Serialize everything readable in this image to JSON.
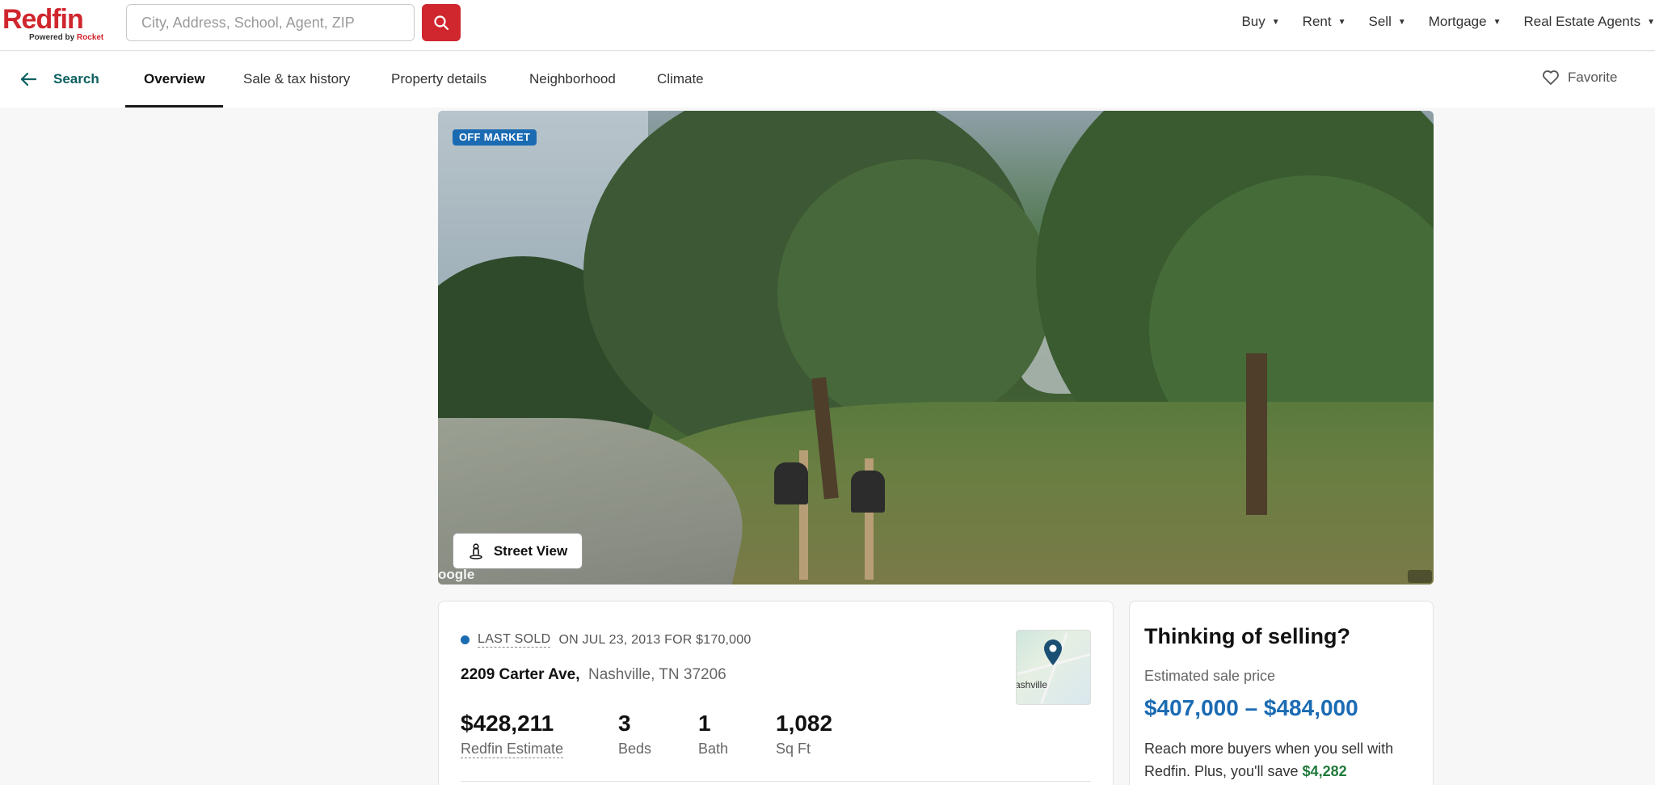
{
  "header": {
    "logo_text": "Redfin",
    "logo_sub_prefix": "Powered by",
    "logo_sub_brand": "Rocket",
    "search_placeholder": "City, Address, School, Agent, ZIP",
    "nav": [
      {
        "label": "Buy"
      },
      {
        "label": "Rent"
      },
      {
        "label": "Sell"
      },
      {
        "label": "Mortgage"
      },
      {
        "label": "Real Estate Agents"
      }
    ]
  },
  "subnav": {
    "back_label": "Search",
    "tabs": [
      {
        "label": "Overview",
        "active": true
      },
      {
        "label": "Sale & tax history"
      },
      {
        "label": "Property details"
      },
      {
        "label": "Neighborhood"
      },
      {
        "label": "Climate"
      }
    ],
    "favorite_label": "Favorite"
  },
  "photo": {
    "badge": "OFF MARKET",
    "street_view_label": "Street View",
    "watermark": "oogle"
  },
  "listing": {
    "sold_label": "LAST SOLD",
    "sold_detail": "ON JUL 23, 2013 FOR $170,000",
    "street": "2209 Carter Ave,",
    "city": "Nashville, TN 37206",
    "map_city_label": "ashville",
    "stats": [
      {
        "value": "$428,211",
        "label": "Redfin Estimate"
      },
      {
        "value": "3",
        "label": "Beds"
      },
      {
        "value": "1",
        "label": "Bath"
      },
      {
        "value": "1,082",
        "label": "Sq Ft"
      }
    ]
  },
  "selling": {
    "title": "Thinking of selling?",
    "subtitle": "Estimated sale price",
    "price_range": "$407,000 – $484,000",
    "text": "Reach more buyers when you sell with Redfin. Plus, you'll save",
    "savings": "$4,282"
  },
  "colors": {
    "brand_red": "#d0262e",
    "accent_blue": "#1b6bb3",
    "teal_link": "#0b5f5f",
    "savings_green": "#1e7a3a"
  }
}
